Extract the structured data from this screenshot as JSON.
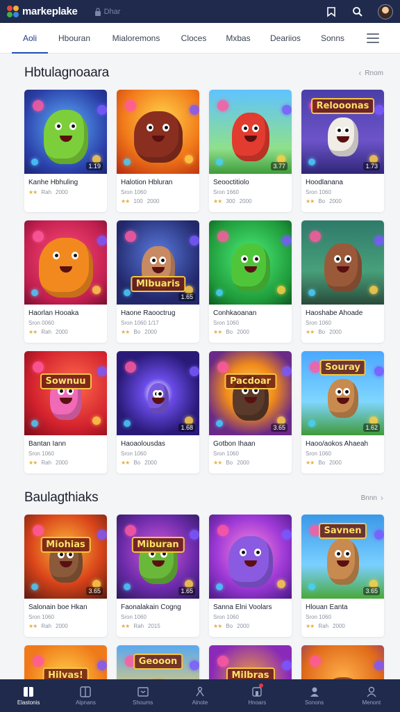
{
  "app": {
    "name": "markeplake",
    "search_placeholder": "Dhar"
  },
  "tabs": [
    {
      "label": "Aoli",
      "active": true
    },
    {
      "label": "Hbouran",
      "active": false
    },
    {
      "label": "Mialoremons",
      "active": false
    },
    {
      "label": "Cloces",
      "active": false
    },
    {
      "label": "Mxbas",
      "active": false
    },
    {
      "label": "Deariios",
      "active": false
    },
    {
      "label": "Sonns",
      "active": false
    }
  ],
  "sections": [
    {
      "title": "Hbtulagnoaara",
      "see_all": "Rnom",
      "cards": [
        {
          "title": "Kanhe Hbhuling",
          "subtitle": "",
          "score": "1.19",
          "rating": "Rah",
          "count": "2000",
          "theme": "green-monster"
        },
        {
          "title": "Halotion Hbluran",
          "subtitle": "Sron 1060",
          "score": "",
          "rating": "100",
          "count": "2000",
          "theme": "brown-bear"
        },
        {
          "title": "Seooctitiolo",
          "subtitle": "Sron 1660",
          "score": "3.77",
          "rating": "300",
          "count": "2000",
          "theme": "red-cat"
        },
        {
          "title": "Hoodlanana",
          "subtitle": "Sron 1060",
          "score": "1.73",
          "rating": "Bo",
          "count": "2000",
          "theme": "squad-banner",
          "banner": "Relooonas"
        },
        {
          "title": "Haorlan Hooaka",
          "subtitle": "Sron 0060",
          "score": "",
          "rating": "Rah",
          "count": "2000",
          "theme": "orange-cat"
        },
        {
          "title": "Haone Raooctrug",
          "subtitle": "Sron 1060 1/17",
          "score": "1.65",
          "rating": "Bo",
          "count": "2000",
          "theme": "hero-banner",
          "banner": "Mlbuaris"
        },
        {
          "title": "Conhkaoanan",
          "subtitle": "Sron 1060",
          "score": "",
          "rating": "Bo",
          "count": "2000",
          "theme": "green-cat"
        },
        {
          "title": "Haoshabe Ahoade",
          "subtitle": "Sron 1060",
          "score": "",
          "rating": "Bo",
          "count": "2000",
          "theme": "bear-squad"
        },
        {
          "title": "Bantan Iann",
          "subtitle": "Sron 1060",
          "score": "",
          "rating": "Rah",
          "count": "2000",
          "theme": "pink-banner",
          "banner": "Sownuu"
        },
        {
          "title": "Haoaolousdas",
          "subtitle": "Sron 1060",
          "score": "1.68",
          "rating": "Bo",
          "count": "2000",
          "theme": "purple-space"
        },
        {
          "title": "Gotbon Ihaan",
          "subtitle": "Sron 1060",
          "score": "3.65",
          "rating": "Bo",
          "count": "2000",
          "theme": "dragon-banner",
          "banner": "Pacdoar"
        },
        {
          "title": "Haoo/aokos Ahaeah",
          "subtitle": "Sron 1060",
          "score": "1.62",
          "rating": "Bo",
          "count": "2000",
          "theme": "souray-banner",
          "banner": "Souray"
        }
      ]
    },
    {
      "title": "Baulagthiaks",
      "see_all": "Bnnn",
      "cards": [
        {
          "title": "Salonain boe Hkan",
          "subtitle": "Sron 1060",
          "score": "3.65",
          "rating": "Rah",
          "count": "2000",
          "theme": "hero-red-banner",
          "banner": "Miohias"
        },
        {
          "title": "Faonalakain Cogng",
          "subtitle": "Sron 1060",
          "score": "1.65",
          "rating": "Rah",
          "count": "2015",
          "theme": "goblin-banner",
          "banner": "Miburan"
        },
        {
          "title": "Sanna Elni Voolars",
          "subtitle": "Sron 1060",
          "score": "",
          "rating": "Bo",
          "count": "2000",
          "theme": "purple-cat"
        },
        {
          "title": "Hlouan Eanta",
          "subtitle": "Sron 1060",
          "score": "3.65",
          "rating": "Rah",
          "count": "2000",
          "theme": "kangaroo-banner",
          "banner": "Savnen"
        },
        {
          "title": "",
          "subtitle": "",
          "score": "",
          "rating": "",
          "count": "",
          "theme": "hilvas-banner",
          "banner": "Hilvas!"
        },
        {
          "title": "",
          "subtitle": "",
          "score": "",
          "rating": "",
          "count": "",
          "theme": "golden-banner",
          "banner": "Geooon"
        },
        {
          "title": "",
          "subtitle": "",
          "score": "",
          "rating": "",
          "count": "",
          "theme": "milbras-banner",
          "banner": "Milbras"
        },
        {
          "title": "",
          "subtitle": "",
          "score": "",
          "rating": "",
          "count": "",
          "theme": "orange-hero"
        }
      ]
    }
  ],
  "bottom_nav": [
    {
      "label": "Elastonis",
      "icon": "home-icon",
      "active": true
    },
    {
      "label": "Alpnans",
      "icon": "library-icon",
      "active": false
    },
    {
      "label": "Shoums",
      "icon": "store-icon",
      "active": false
    },
    {
      "label": "Alnote",
      "icon": "share-icon",
      "active": false
    },
    {
      "label": "Hnoars",
      "icon": "inbox-icon",
      "active": false
    },
    {
      "label": "Sonons",
      "icon": "friends-icon",
      "active": false
    },
    {
      "label": "Menont",
      "icon": "profile-icon",
      "active": false
    }
  ],
  "colors": {
    "topbar": "#1f2a4d",
    "accent": "#1f4ab8",
    "background": "#f4f5f7"
  }
}
